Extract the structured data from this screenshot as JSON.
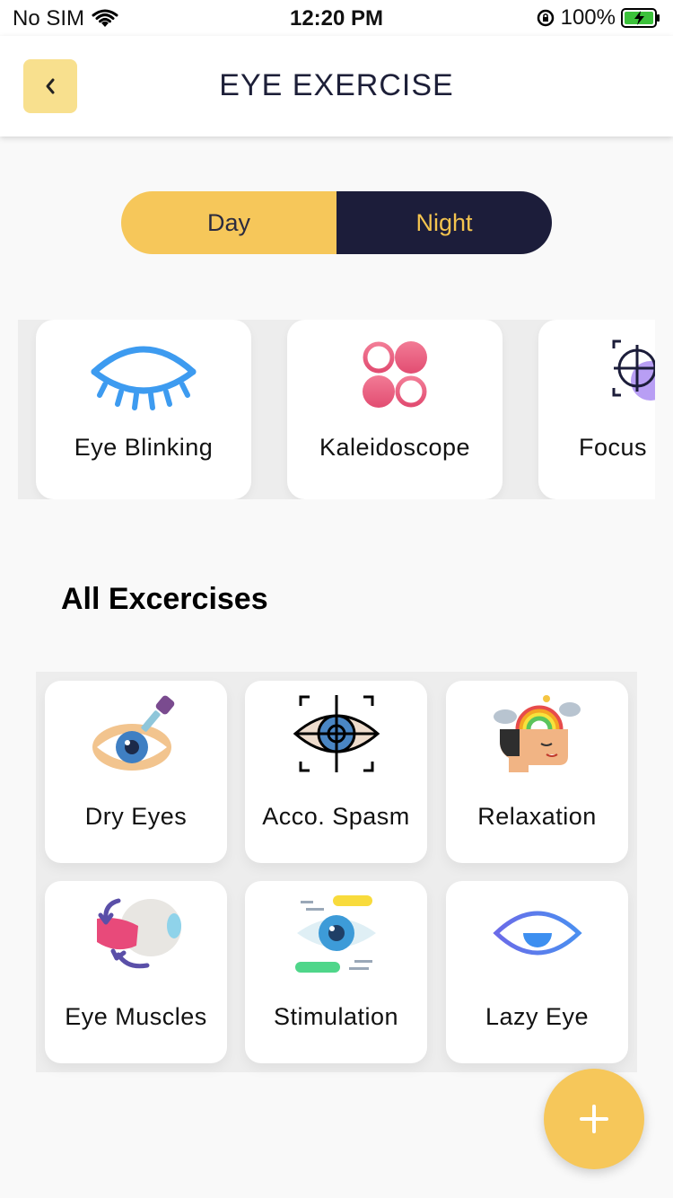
{
  "status_bar": {
    "carrier": "No SIM",
    "time": "12:20 PM",
    "battery": "100%"
  },
  "header": {
    "title": "EYE EXERCISE"
  },
  "mode_toggle": {
    "day_label": "Day",
    "night_label": "Night",
    "selected": "Day"
  },
  "featured": [
    {
      "label": "Eye Blinking",
      "icon": "eye-blinking-icon"
    },
    {
      "label": "Kaleidoscope",
      "icon": "kaleidoscope-icon"
    },
    {
      "label": "Focus",
      "icon": "focus-icon"
    }
  ],
  "section": {
    "title": "All Excercises"
  },
  "exercises": [
    {
      "label": "Dry Eyes",
      "icon": "eye-dropper-icon"
    },
    {
      "label": "Acco. Spasm",
      "icon": "eye-target-icon"
    },
    {
      "label": "Relaxation",
      "icon": "relaxation-head-icon"
    },
    {
      "label": "Eye Muscles",
      "icon": "eye-muscles-icon"
    },
    {
      "label": "Stimulation",
      "icon": "stimulation-eye-icon"
    },
    {
      "label": "Lazy Eye",
      "icon": "lazy-eye-icon"
    }
  ],
  "colors": {
    "accent_yellow": "#f6c75a",
    "navy": "#1c1d3a",
    "back_button": "#f8e08e",
    "blue": "#3d9bf0",
    "pink": "#e85a7c"
  }
}
